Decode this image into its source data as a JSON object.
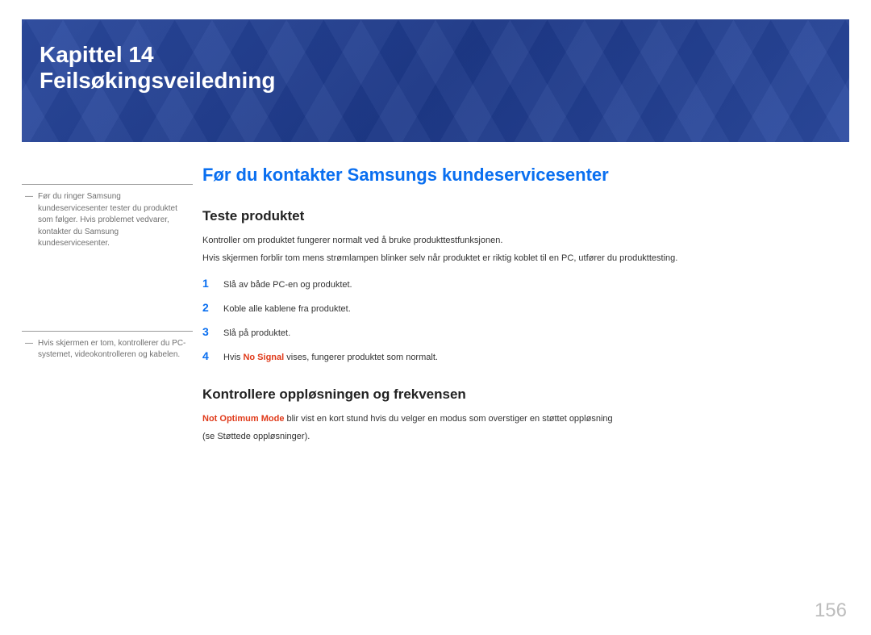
{
  "header": {
    "chapter_label": "Kapittel 14",
    "chapter_title": "Feilsøkingsveiledning"
  },
  "side_notes": {
    "note1": "Før du ringer Samsung kundeservicesenter tester du produktet som følger. Hvis problemet vedvarer, kontakter du Samsung kundeservicesenter.",
    "note2": "Hvis skjermen er tom, kontrollerer du PC-systemet, videokontrolleren og kabelen."
  },
  "main": {
    "heading": "Før du kontakter Samsungs kundeservicesenter",
    "section1": {
      "title": "Teste produktet",
      "p1": "Kontroller om produktet fungerer normalt ved å bruke produkttestfunksjonen.",
      "p2": "Hvis skjermen forblir tom mens strømlampen blinker selv når produktet er riktig koblet til en PC, utfører du produkttesting.",
      "steps": [
        {
          "n": "1",
          "t": "Slå av både PC-en og produktet."
        },
        {
          "n": "2",
          "t": "Koble alle kablene fra produktet."
        },
        {
          "n": "3",
          "t": "Slå på produktet."
        },
        {
          "n": "4",
          "t_pre": "Hvis ",
          "bold": "No Signal",
          "t_post": " vises, fungerer produktet som normalt."
        }
      ]
    },
    "section2": {
      "title": "Kontrollere oppløsningen og frekvensen",
      "bold": "Not Optimum Mode",
      "p1_post": " blir vist en kort stund hvis du velger en modus som overstiger en støttet oppløsning",
      "p2": "(se Støttede oppløsninger)."
    }
  },
  "page_number": "156"
}
